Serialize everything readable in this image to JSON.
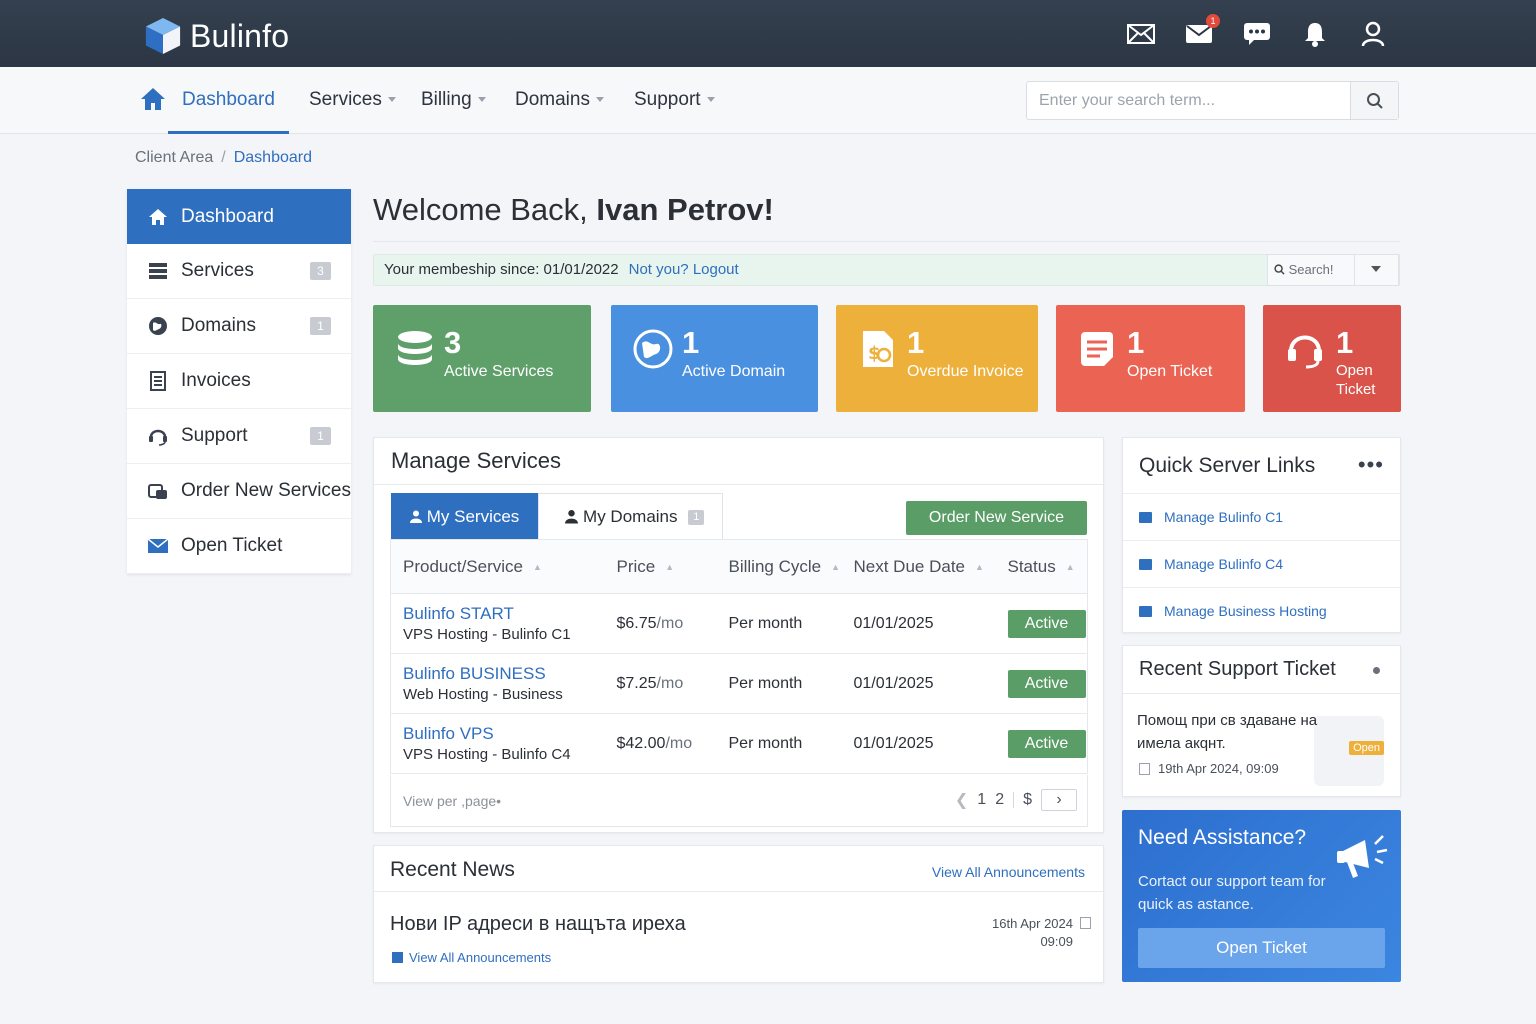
{
  "brand": {
    "name": "Bulinfo"
  },
  "topbar": {
    "mail_badge": "1"
  },
  "nav": {
    "items": [
      {
        "label": "Dashboard"
      },
      {
        "label": "Services"
      },
      {
        "label": "Billing"
      },
      {
        "label": "Domains"
      },
      {
        "label": "Support"
      }
    ],
    "search_placeholder": "Enter your search term..."
  },
  "breadcrumb": {
    "root": "Client Area",
    "sep": "/",
    "current": "Dashboard"
  },
  "sidebar": {
    "items": [
      {
        "label": "Dashboard"
      },
      {
        "label": "Services",
        "count": "3"
      },
      {
        "label": "Domains",
        "count": "1"
      },
      {
        "label": "Invoices"
      },
      {
        "label": "Support",
        "count": "1"
      },
      {
        "label": "Order New Services"
      },
      {
        "label": "Open Ticket"
      }
    ]
  },
  "welcome": {
    "prefix": "Welcome Back,",
    "name": "Ivan Petrov!"
  },
  "membership": {
    "text": "Your membeship since: 01/01/2022",
    "logout": "Not you? Logout",
    "search": "Search!"
  },
  "tiles": [
    {
      "num": "3",
      "label": "Active Services",
      "color": "#5e9f6a"
    },
    {
      "num": "1",
      "label": "Active Domain",
      "color": "#4a90e0"
    },
    {
      "num": "1",
      "label": "Overdue Invoice",
      "color": "#edb03a"
    },
    {
      "num": "1",
      "label": "Open Ticket",
      "color": "#eb6353"
    },
    {
      "num": "1",
      "label": "Open Ticket",
      "color": "#d9534a"
    }
  ],
  "manage": {
    "title": "Manage Services",
    "tab_services": "My Services",
    "tab_domains": "My Domains",
    "tab_domains_count": "1",
    "order_button": "Order New Service",
    "columns": [
      "Product/Service",
      "Price",
      "Billing Cycle",
      "Next Due Date",
      "Status"
    ],
    "rows": [
      {
        "name": "Bulinfo START",
        "sub": "VPS Hosting - Bulinfo C1",
        "price": "$6.75",
        "per": "/mo",
        "cycle": "Per month",
        "due": "01/01/2025",
        "status": "Active"
      },
      {
        "name": "Bulinfo BUSINESS",
        "sub": "Web Hosting - Business",
        "price": "$7.25",
        "per": "/mo",
        "cycle": "Per month",
        "due": "01/01/2025",
        "status": "Active"
      },
      {
        "name": "Bulinfo VPS",
        "sub": "VPS Hosting - Bulinfo C4",
        "price": "$42.00",
        "per": "/mo",
        "cycle": "Per month",
        "due": "01/01/2025",
        "status": "Active"
      }
    ],
    "footer_text": "View per ,page•",
    "pages": [
      "1",
      "2",
      "$"
    ]
  },
  "news": {
    "title": "Recent News",
    "view_all": "View All Announcements",
    "item_title": "Нови IP адреси в нащъта ирехa",
    "item_date": "16th Apr 2024",
    "item_time": "09:09",
    "item_link": "View All Announcements"
  },
  "quick_links": {
    "title": "Quick Server Links",
    "items": [
      "Manage Bulinfo C1",
      "Manage Bulinfo C4",
      "Manage Business Hosting"
    ]
  },
  "support_ticket": {
    "title": "Recent Support Ticket",
    "subject": "Помощ при св здаване на имела aкqнт.",
    "badge": "Open",
    "date": "19th Apr 2024, 09:09"
  },
  "assistance": {
    "title": "Need Assistance?",
    "desc": "Cortact our support team for quick as astance.",
    "button": "Open Ticket"
  }
}
